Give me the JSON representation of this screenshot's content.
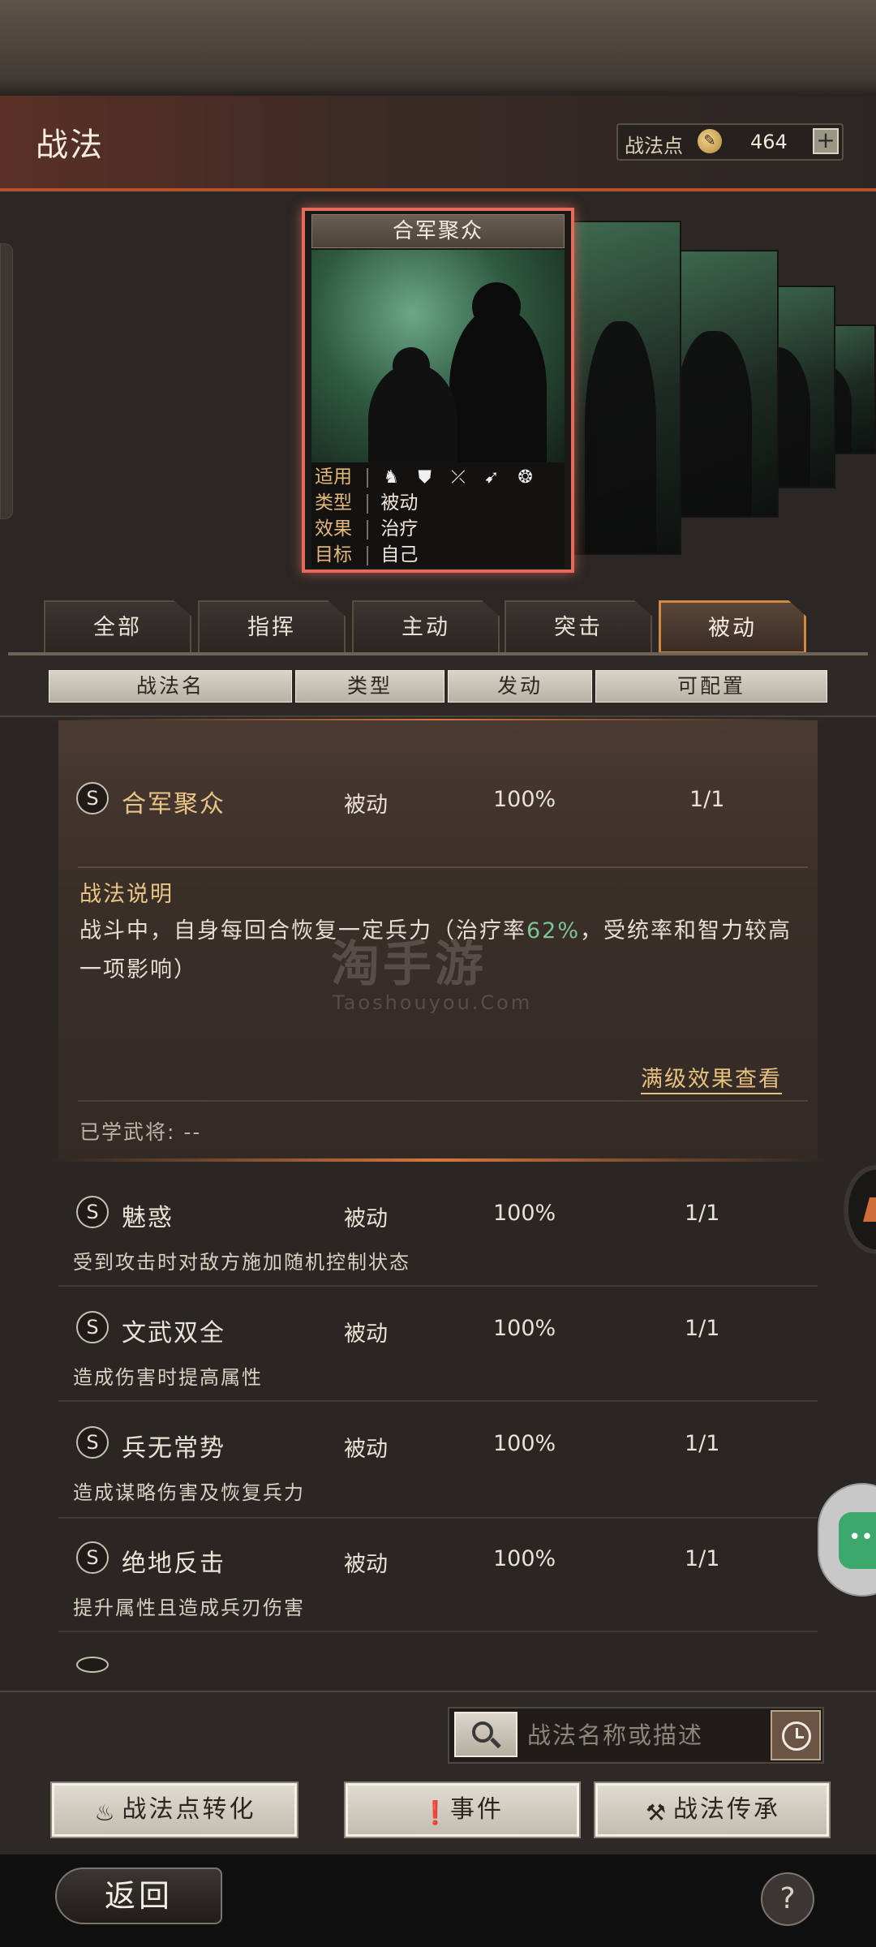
{
  "header": {
    "title": "战法",
    "points_label": "战法点",
    "points_value": "464",
    "add_label": "+"
  },
  "featured_card": {
    "name": "合军聚众",
    "applicable_label": "适用",
    "type_label": "类型",
    "type_value": "被动",
    "effect_label": "效果",
    "effect_value": "治疗",
    "target_label": "目标",
    "target_value": "自己",
    "unit_icons": [
      "cavalry-icon",
      "shield-icon",
      "bow-icon",
      "spear-icon",
      "wheel-icon"
    ]
  },
  "tabs": [
    {
      "label": "全部"
    },
    {
      "label": "指挥"
    },
    {
      "label": "主动"
    },
    {
      "label": "突击"
    },
    {
      "label": "被动"
    }
  ],
  "active_tab": 4,
  "table_headers": {
    "name": "战法名",
    "type": "类型",
    "trigger": "发动",
    "configurable": "可配置"
  },
  "expanded": {
    "grade": "S",
    "name": "合军聚众",
    "type": "被动",
    "trigger": "100%",
    "configurable": "1/1",
    "desc_title": "战法说明",
    "desc_part1": "战斗中，自身每回合恢复一定兵力（治疗率",
    "desc_highlight": "62%",
    "desc_part2": "，受统率和智力较高一项影响）",
    "max_effect_link": "满级效果查看",
    "learned_label": "已学武将: --"
  },
  "rows": [
    {
      "grade": "S",
      "name": "魅惑",
      "type": "被动",
      "trigger": "100%",
      "configurable": "1/1",
      "desc": "受到攻击时对敌方施加随机控制状态"
    },
    {
      "grade": "S",
      "name": "文武双全",
      "type": "被动",
      "trigger": "100%",
      "configurable": "1/1",
      "desc": "造成伤害时提高属性"
    },
    {
      "grade": "S",
      "name": "兵无常势",
      "type": "被动",
      "trigger": "100%",
      "configurable": "1/1",
      "desc": "造成谋略伤害及恢复兵力"
    },
    {
      "grade": "S",
      "name": "绝地反击",
      "type": "被动",
      "trigger": "100%",
      "configurable": "1/1",
      "desc": "提升属性且造成兵刃伤害"
    }
  ],
  "watermark": {
    "main": "淘手游",
    "sub": "Taoshouyou.Com"
  },
  "search": {
    "placeholder": "战法名称或描述"
  },
  "bottom_buttons": {
    "convert": "战法点转化",
    "events": "事件",
    "inherit": "战法传承"
  },
  "footer": {
    "back": "返回",
    "help": "?"
  },
  "colors": {
    "accent_gold": "#ebc584",
    "highlight_green": "#7cc592",
    "active_tab_border": "#d2893f",
    "card_border": "#e46a5c"
  }
}
